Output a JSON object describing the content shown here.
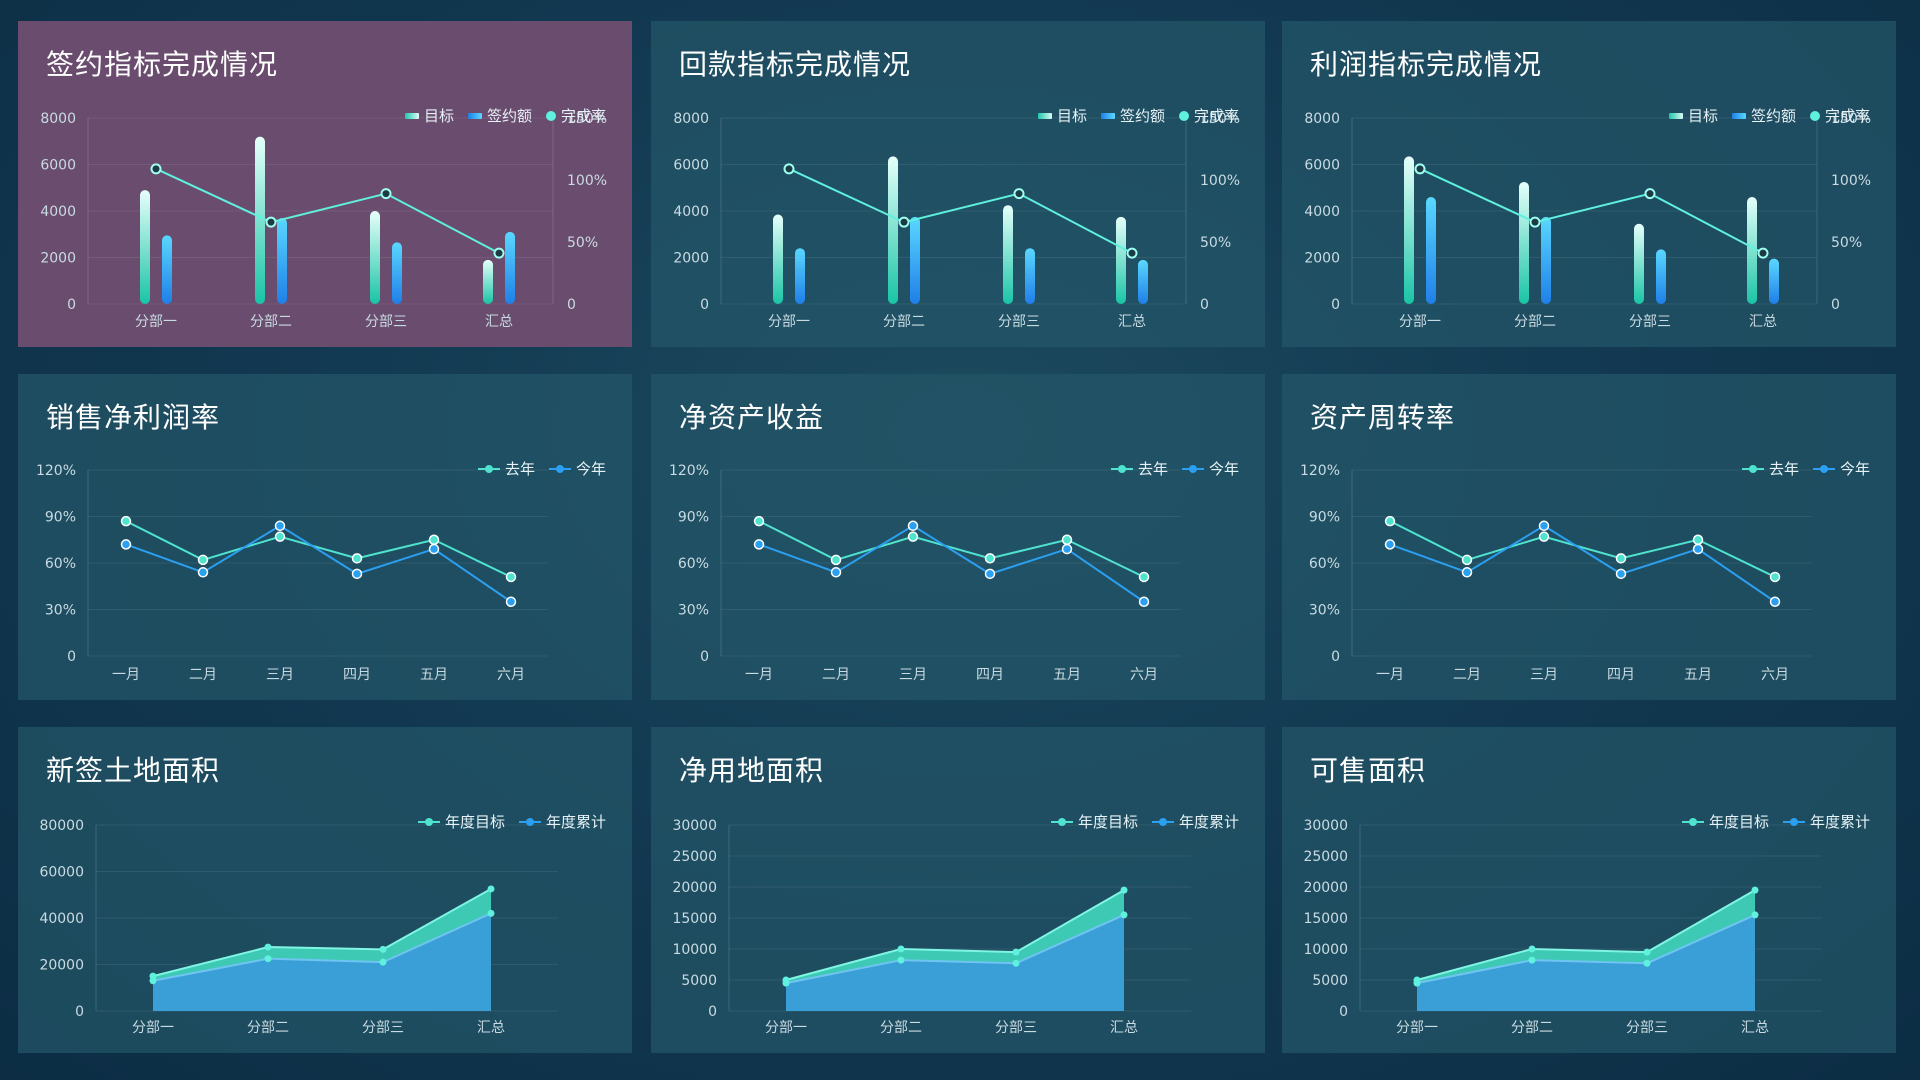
{
  "colors": {
    "teal": "#4fe3cf",
    "blue": "#2b9ff0",
    "cyan_dot": "#5ff0de",
    "active_panel": "#6a4c6e"
  },
  "panels": [
    {
      "title": "签约指标完成情况",
      "active": true,
      "legend": [
        "目标",
        "签约额",
        "完成率"
      ],
      "chart_data": {
        "type": "bar",
        "categories": [
          "分部一",
          "分部二",
          "分部三",
          "汇总"
        ],
        "series": [
          {
            "name": "目标",
            "values": [
              4900,
              7200,
              4000,
              1900
            ]
          },
          {
            "name": "签约额",
            "values": [
              2950,
              3700,
              2650,
              3100
            ]
          },
          {
            "name": "完成率",
            "values": [
              109,
              66,
              89,
              41
            ]
          }
        ],
        "ylim": [
          0,
          8000
        ],
        "y_ticks": [
          "0",
          "2000",
          "4000",
          "6000",
          "8000"
        ],
        "y2lim": [
          0,
          150
        ],
        "y2_ticks": [
          "0",
          "50%",
          "100%",
          "150%"
        ]
      }
    },
    {
      "title": "回款指标完成情况",
      "active": false,
      "legend": [
        "目标",
        "签约额",
        "完成率"
      ],
      "chart_data": {
        "type": "bar",
        "categories": [
          "分部一",
          "分部二",
          "分部三",
          "汇总"
        ],
        "series": [
          {
            "name": "目标",
            "values": [
              3850,
              6350,
              4250,
              3750
            ]
          },
          {
            "name": "签约额",
            "values": [
              2400,
              3750,
              2400,
              1900
            ]
          },
          {
            "name": "完成率",
            "values": [
              109,
              66,
              89,
              41
            ]
          }
        ],
        "ylim": [
          0,
          8000
        ],
        "y_ticks": [
          "0",
          "2000",
          "4000",
          "6000",
          "8000"
        ],
        "y2lim": [
          0,
          150
        ],
        "y2_ticks": [
          "0",
          "50%",
          "100%",
          "150%"
        ]
      }
    },
    {
      "title": "利润指标完成情况",
      "active": false,
      "legend": [
        "目标",
        "签约额",
        "完成率"
      ],
      "chart_data": {
        "type": "bar",
        "categories": [
          "分部一",
          "分部二",
          "分部三",
          "汇总"
        ],
        "series": [
          {
            "name": "目标",
            "values": [
              6350,
              5250,
              3450,
              4600
            ]
          },
          {
            "name": "签约额",
            "values": [
              4600,
              3750,
              2350,
              1950
            ]
          },
          {
            "name": "完成率",
            "values": [
              109,
              66,
              89,
              41
            ]
          }
        ],
        "ylim": [
          0,
          8000
        ],
        "y_ticks": [
          "0",
          "2000",
          "4000",
          "6000",
          "8000"
        ],
        "y2lim": [
          0,
          150
        ],
        "y2_ticks": [
          "0",
          "50%",
          "100%",
          "150%"
        ]
      }
    },
    {
      "title": "销售净利润率",
      "active": false,
      "legend": [
        "去年",
        "今年"
      ],
      "chart_data": {
        "type": "line",
        "categories": [
          "一月",
          "二月",
          "三月",
          "四月",
          "五月",
          "六月"
        ],
        "series": [
          {
            "name": "去年",
            "values": [
              87,
              62,
              77,
              63,
              75,
              51
            ]
          },
          {
            "name": "今年",
            "values": [
              72,
              54,
              84,
              53,
              69,
              35
            ]
          }
        ],
        "ylim": [
          0,
          120
        ],
        "y_ticks": [
          "0",
          "30%",
          "60%",
          "90%",
          "120%"
        ]
      }
    },
    {
      "title": "净资产收益",
      "active": false,
      "legend": [
        "去年",
        "今年"
      ],
      "chart_data": {
        "type": "line",
        "categories": [
          "一月",
          "二月",
          "三月",
          "四月",
          "五月",
          "六月"
        ],
        "series": [
          {
            "name": "去年",
            "values": [
              87,
              62,
              77,
              63,
              75,
              51
            ]
          },
          {
            "name": "今年",
            "values": [
              72,
              54,
              84,
              53,
              69,
              35
            ]
          }
        ],
        "ylim": [
          0,
          120
        ],
        "y_ticks": [
          "0",
          "30%",
          "60%",
          "90%",
          "120%"
        ]
      }
    },
    {
      "title": "资产周转率",
      "active": false,
      "legend": [
        "去年",
        "今年"
      ],
      "chart_data": {
        "type": "line",
        "categories": [
          "一月",
          "二月",
          "三月",
          "四月",
          "五月",
          "六月"
        ],
        "series": [
          {
            "name": "去年",
            "values": [
              87,
              62,
              77,
              63,
              75,
              51
            ]
          },
          {
            "name": "今年",
            "values": [
              72,
              54,
              84,
              53,
              69,
              35
            ]
          }
        ],
        "ylim": [
          0,
          120
        ],
        "y_ticks": [
          "0",
          "30%",
          "60%",
          "90%",
          "120%"
        ]
      }
    },
    {
      "title": "新签土地面积",
      "active": false,
      "legend": [
        "年度目标",
        "年度累计"
      ],
      "chart_data": {
        "type": "area",
        "categories": [
          "分部一",
          "分部二",
          "分部三",
          "汇总"
        ],
        "series": [
          {
            "name": "年度目标",
            "values": [
              15000,
              27500,
              26500,
              52500
            ]
          },
          {
            "name": "年度累计",
            "values": [
              13000,
              22500,
              21000,
              42000
            ]
          }
        ],
        "ylim": [
          0,
          80000
        ],
        "y_ticks": [
          "0",
          "20000",
          "40000",
          "60000",
          "80000"
        ]
      }
    },
    {
      "title": "净用地面积",
      "active": false,
      "legend": [
        "年度目标",
        "年度累计"
      ],
      "chart_data": {
        "type": "area",
        "categories": [
          "分部一",
          "分部二",
          "分部三",
          "汇总"
        ],
        "series": [
          {
            "name": "年度目标",
            "values": [
              5000,
              10000,
              9500,
              19500
            ]
          },
          {
            "name": "年度累计",
            "values": [
              4500,
              8200,
              7700,
              15500
            ]
          }
        ],
        "ylim": [
          0,
          30000
        ],
        "y_ticks": [
          "0",
          "5000",
          "10000",
          "15000",
          "20000",
          "25000",
          "30000"
        ]
      }
    },
    {
      "title": "可售面积",
      "active": false,
      "legend": [
        "年度目标",
        "年度累计"
      ],
      "chart_data": {
        "type": "area",
        "categories": [
          "分部一",
          "分部二",
          "分部三",
          "汇总"
        ],
        "series": [
          {
            "name": "年度目标",
            "values": [
              5000,
              10000,
              9500,
              19500
            ]
          },
          {
            "name": "年度累计",
            "values": [
              4500,
              8200,
              7700,
              15500
            ]
          }
        ],
        "ylim": [
          0,
          30000
        ],
        "y_ticks": [
          "0",
          "5000",
          "10000",
          "15000",
          "20000",
          "25000",
          "30000"
        ]
      }
    }
  ]
}
